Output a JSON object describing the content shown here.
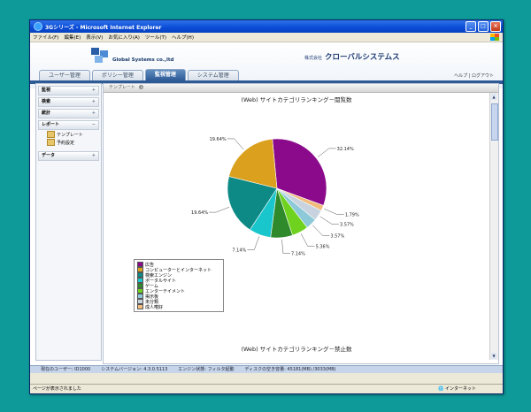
{
  "window": {
    "title": "3Gシリーズ - Microsoft Internet Explorer"
  },
  "menu": [
    "ファイル(F)",
    "編集(E)",
    "表示(V)",
    "お気に入り(A)",
    "ツール(T)",
    "ヘルプ(H)"
  ],
  "header": {
    "logo_text": "Global Systems co.,ltd",
    "company_prefix": "株式会社",
    "company_name": "クローバルシステムス",
    "help_link": "ヘルプ | ログアウト"
  },
  "tabs": [
    {
      "label": "ユーザー管理",
      "active": false
    },
    {
      "label": "ポリシー管理",
      "active": false
    },
    {
      "label": "監視管理",
      "active": true
    },
    {
      "label": "システム管理",
      "active": false
    }
  ],
  "sidebar": {
    "sections": [
      {
        "label": "監視",
        "icon": "plus"
      },
      {
        "label": "検索",
        "icon": "plus"
      },
      {
        "label": "統計",
        "icon": "plus"
      },
      {
        "label": "レポート",
        "icon": "minus"
      },
      {
        "label": "データ",
        "icon": "plus"
      }
    ],
    "report_items": [
      "テンプレート",
      "予約設定"
    ]
  },
  "breadcrumb": {
    "label": "テンプレート"
  },
  "chart_data": {
    "type": "pie",
    "title": "(Web) サイトカテゴリランキング－閲覧数",
    "categories": [
      "広告",
      "コンピューターとインターネット",
      "検索エンジン",
      "ポータルサイト",
      "ゲーム",
      "エンターテイメント",
      "掲示板",
      "未分類",
      "成人嗜好"
    ],
    "values": [
      32.14,
      19.64,
      19.64,
      7.14,
      7.14,
      5.36,
      3.57,
      3.57,
      1.79
    ],
    "labels": [
      "32.14%",
      "19.64%",
      "19.64%",
      "7.14%",
      "7.14%",
      "5.36%",
      "3.57%",
      "3.57%",
      "1.79%"
    ],
    "colors": [
      "#8b0a8b",
      "#dba11e",
      "#0e8a86",
      "#18c6cc",
      "#2f8a2b",
      "#6fd21f",
      "#8dc9d8",
      "#c8d3df",
      "#f1bc7c"
    ],
    "legend_position": "bottom-left"
  },
  "second_chart_title": "(Web) サイトカテゴリランキング－禁止数",
  "statusbar": {
    "user": "現在のユーザー: ID1000",
    "version": "システムバージョン: 4.3.0.5113",
    "engine": "エンジン状態: フィルタ起動",
    "disk": "ディスクの空き容量: 45181(MB) /3033(MB)"
  },
  "ie_status": {
    "left": "ページが表示されました",
    "right": "インターネット"
  }
}
